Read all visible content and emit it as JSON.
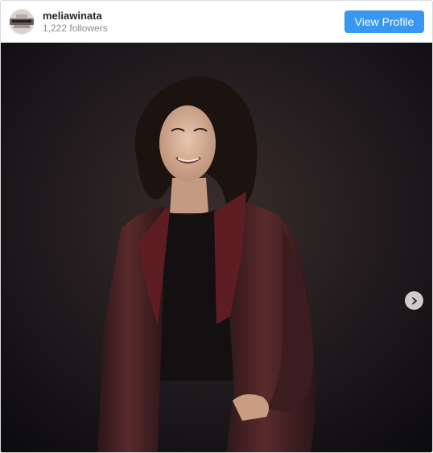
{
  "header": {
    "username": "meliawinata",
    "followers": "1,222 followers",
    "view_profile_label": "View Profile"
  },
  "icons": {
    "avatar": "profile-avatar",
    "carousel_next": "chevron-right-icon"
  },
  "colors": {
    "button": "#3897f0",
    "border": "#dbdbdb",
    "username": "#262626",
    "followers": "#8e8e8e"
  }
}
